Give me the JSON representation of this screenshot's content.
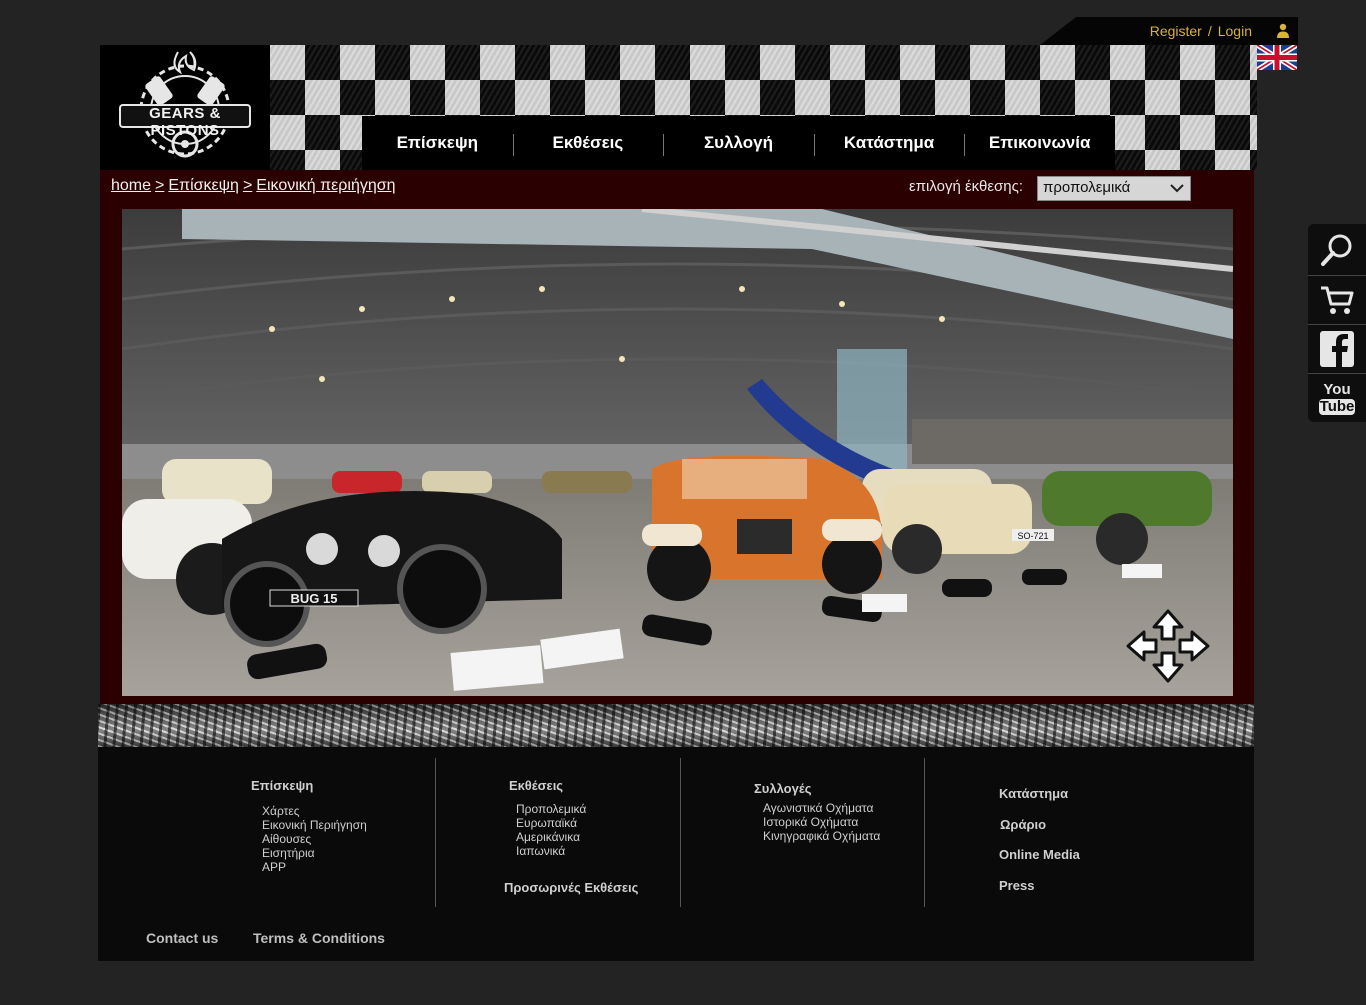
{
  "login": {
    "register": "Register",
    "separator": "/",
    "login": "Login"
  },
  "logo": {
    "line1": "GEARS & PISTONS"
  },
  "nav": [
    {
      "label": "Επίσκεψη"
    },
    {
      "label": "Εκθέσεις"
    },
    {
      "label": "Συλλογή"
    },
    {
      "label": "Κατάστημα"
    },
    {
      "label": "Επικοινωνία"
    }
  ],
  "breadcrumb": {
    "home": "home",
    "sep1": ">",
    "visit": "Επίσκεψη",
    "sep2": ">",
    "current": "Εικονική περιήγηση"
  },
  "exhibit": {
    "label": "επιλογή έκθεσης:",
    "selected": "προπολεμικά"
  },
  "viewer": {
    "plate_left": "BUG 15",
    "plate_right": "SO-721"
  },
  "footer": {
    "visit": {
      "title": "Επίσκεψη",
      "links": [
        "Χάρτες",
        "Εικονική Περιήγηση",
        "Αίθουσες",
        "Εισητήρια",
        "APP"
      ]
    },
    "exhibitions": {
      "title": "Εκθέσεις",
      "links": [
        "Προπολεμικά",
        "Ευρωπαϊκά",
        "Αμερικάνικα",
        "Ιαπωνικά"
      ],
      "temporary": "Προσωρινές Εκθέσεις"
    },
    "collections": {
      "title": "Συλλογές",
      "links": [
        "Αγωνιστικά Οχήματα",
        "Ιστορικά Οχήματα",
        "Κινηγραφικά Οχήματα"
      ]
    },
    "right": {
      "shop": "Κατάστημα",
      "hours": "Ωράριο",
      "media": "Online Media",
      "press": "Press"
    },
    "bottom": {
      "contact": "Contact us",
      "terms": "Terms & Conditions"
    }
  },
  "sidebar": {
    "youtube_top": "You",
    "youtube_bottom": "Tube"
  }
}
